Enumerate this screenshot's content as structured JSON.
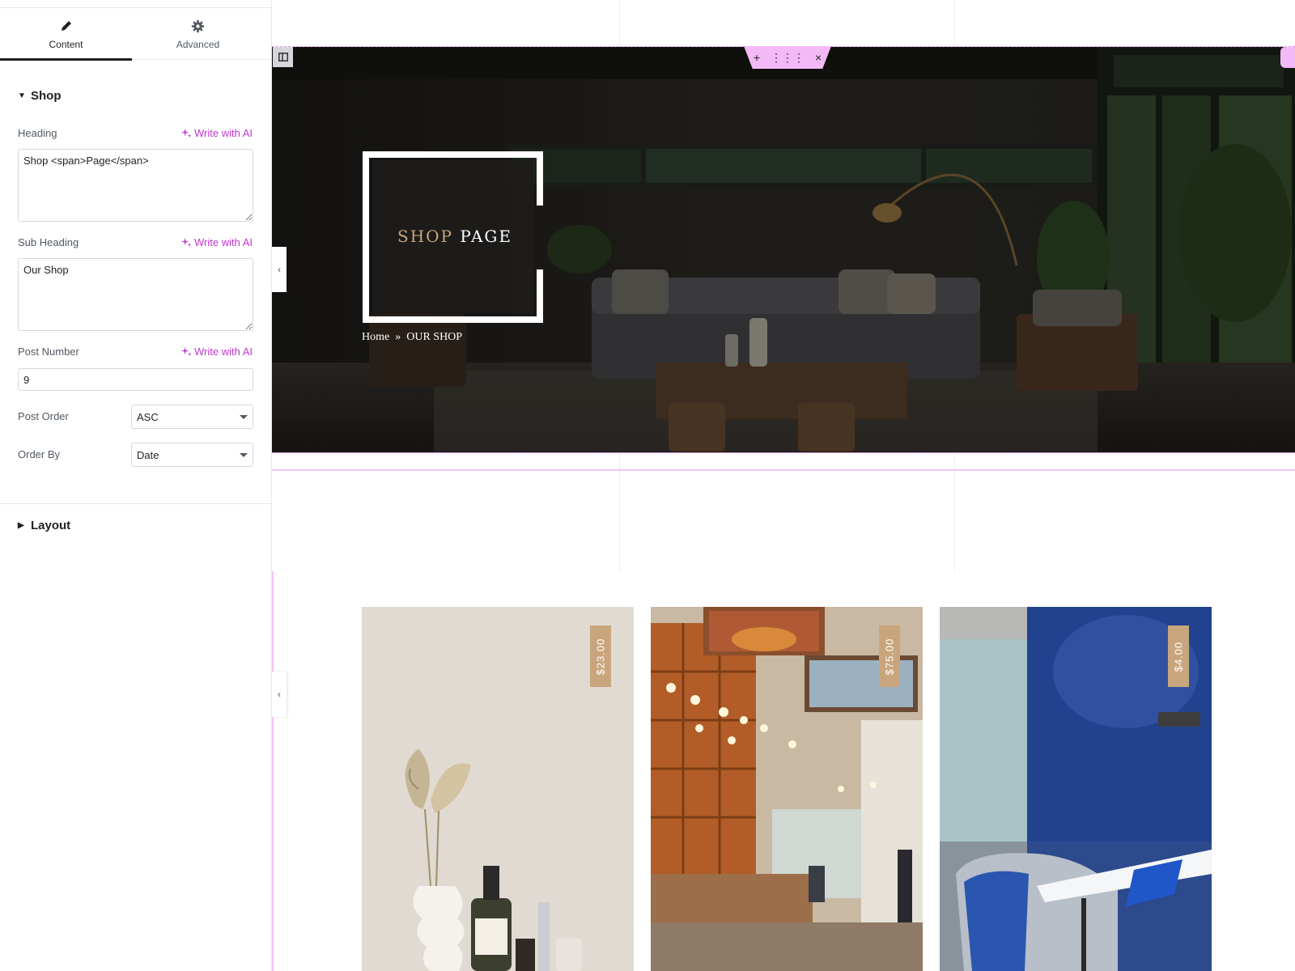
{
  "panel": {
    "tabs": [
      {
        "label": "Content",
        "icon": "pencil-icon",
        "active": true
      },
      {
        "label": "Advanced",
        "icon": "gear-icon",
        "active": false
      }
    ],
    "shop_section": {
      "title": "Shop",
      "heading": {
        "label": "Heading",
        "ai_label": "Write with AI",
        "value": "Shop <span>Page</span>"
      },
      "sub_heading": {
        "label": "Sub Heading",
        "ai_label": "Write with AI",
        "value": "Our Shop"
      },
      "post_number": {
        "label": "Post Number",
        "ai_label": "Write with AI",
        "value": "9"
      },
      "post_order": {
        "label": "Post Order",
        "value": "ASC"
      },
      "order_by": {
        "label": "Order By",
        "value": "Date"
      }
    },
    "layout_section": {
      "title": "Layout"
    }
  },
  "canvas": {
    "hero": {
      "title_accent": "SHOP",
      "title_main": "PAGE",
      "breadcrumb": {
        "home": "Home",
        "separator": "»",
        "current": "OUR SHOP"
      }
    },
    "toolbar": {
      "add": "+",
      "drag": "⋮⋮⋮",
      "close": "×"
    },
    "products": [
      {
        "price": "$23.00"
      },
      {
        "price": "$75.00"
      },
      {
        "price": "$4.00"
      }
    ],
    "colors": {
      "accent_gold": "#c9a57d",
      "ai_purple": "#c036d1",
      "editor_pink": "#f3b9f7"
    }
  }
}
